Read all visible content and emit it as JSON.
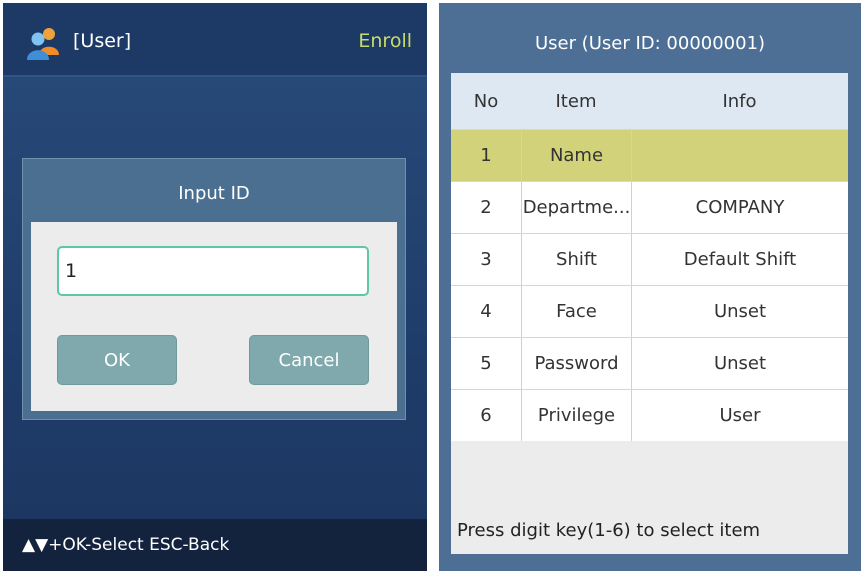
{
  "left_screen": {
    "title": "[User]",
    "mode": "Enroll",
    "icon": "user-group-icon",
    "dialog": {
      "title": "Input ID",
      "input_value": "1",
      "ok_label": "OK",
      "cancel_label": "Cancel"
    },
    "footer": "▲▼+OK-Select ESC-Back"
  },
  "right_screen": {
    "title": "User (User ID: 00000001)",
    "table": {
      "headers": [
        "No",
        "Item",
        "Info"
      ],
      "rows": [
        {
          "no": "1",
          "item": "Name",
          "info": ""
        },
        {
          "no": "2",
          "item": "Departme...",
          "info": "COMPANY"
        },
        {
          "no": "3",
          "item": "Shift",
          "info": "Default Shift"
        },
        {
          "no": "4",
          "item": "Face",
          "info": "Unset"
        },
        {
          "no": "5",
          "item": "Password",
          "info": "Unset"
        },
        {
          "no": "6",
          "item": "Privilege",
          "info": "User"
        }
      ],
      "selected_row": 0
    },
    "hint": "Press digit key(1-6) to select item"
  },
  "colors": {
    "left_bg": "#1e3761",
    "dialog_bg": "#4b6f91",
    "button_bg": "#7fa9ac",
    "input_border": "#5ec7a6",
    "enroll_text": "#c8dc6a",
    "right_bg": "#4d6f95",
    "selected_row": "#d2d27a",
    "header_row": "#dde8f3"
  }
}
